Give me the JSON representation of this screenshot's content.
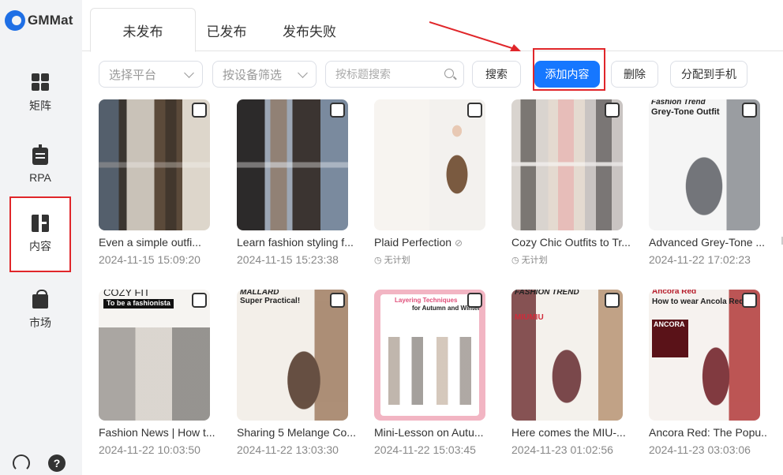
{
  "app": {
    "logo_text": "GMMat"
  },
  "sidebar": {
    "items": [
      {
        "label": "矩阵",
        "icon": "grid-icon"
      },
      {
        "label": "RPA",
        "icon": "robot-icon"
      },
      {
        "label": "内容",
        "icon": "book-icon"
      },
      {
        "label": "市场",
        "icon": "bag-icon"
      }
    ],
    "help_text": "?"
  },
  "tabs": [
    {
      "label": "未发布"
    },
    {
      "label": "已发布"
    },
    {
      "label": "发布失败"
    }
  ],
  "toolbar": {
    "platform_select": "选择平台",
    "device_select": "按设备筛选",
    "search_placeholder": "按标题搜索",
    "search_button": "搜索",
    "add_button": "添加内容",
    "delete_button": "删除",
    "assign_button": "分配到手机"
  },
  "cards": [
    {
      "title": "Even a simple outfi...",
      "date": "2024-11-15 15:09:20",
      "thumb_text": ""
    },
    {
      "title": "Learn fashion styling f...",
      "date": "2024-11-15 15:23:38",
      "thumb_text": ""
    },
    {
      "title": "Plaid Perfection",
      "date": "",
      "status": "无计划",
      "thumb_text": ""
    },
    {
      "title": "Cozy Chic Outfits to Tr...",
      "date": "",
      "status": "无计划",
      "thumb_text": ""
    },
    {
      "title": "Advanced Grey-Tone ...",
      "date": "2024-11-22 17:02:23",
      "thumb_text": "Fashion Trend",
      "thumb_text2": "Grey-Tone Outfit"
    },
    {
      "title": "Fashion News | How t...",
      "date": "2024-11-22 10:03:50",
      "thumb_text": "COZY FIT",
      "thumb_text2": "To be a fashionista"
    },
    {
      "title": "Sharing 5 Melange Co...",
      "date": "2024-11-22 13:03:30",
      "thumb_text": "MALLARD",
      "thumb_text2": "Super Practical!"
    },
    {
      "title": "Mini-Lesson on Autu...",
      "date": "2024-11-22 15:03:45",
      "thumb_text": "Layering Techniques",
      "thumb_text2": "for Autumn and Winter"
    },
    {
      "title": "Here comes the MIU-...",
      "date": "2024-11-23 01:02:56",
      "thumb_text": "FASHION TREND",
      "thumb_text2": "MIUMIU"
    },
    {
      "title": "Ancora Red: The Popu...",
      "date": "2024-11-23 03:03:06",
      "thumb_text": "Ancora Red",
      "thumb_text2": "How to wear Ancola Red",
      "thumb_text3": "ANCORA"
    }
  ],
  "colors": {
    "primary": "#1677ff",
    "highlight": "#e0262a",
    "sidebar_bg": "#f2f3f5"
  }
}
